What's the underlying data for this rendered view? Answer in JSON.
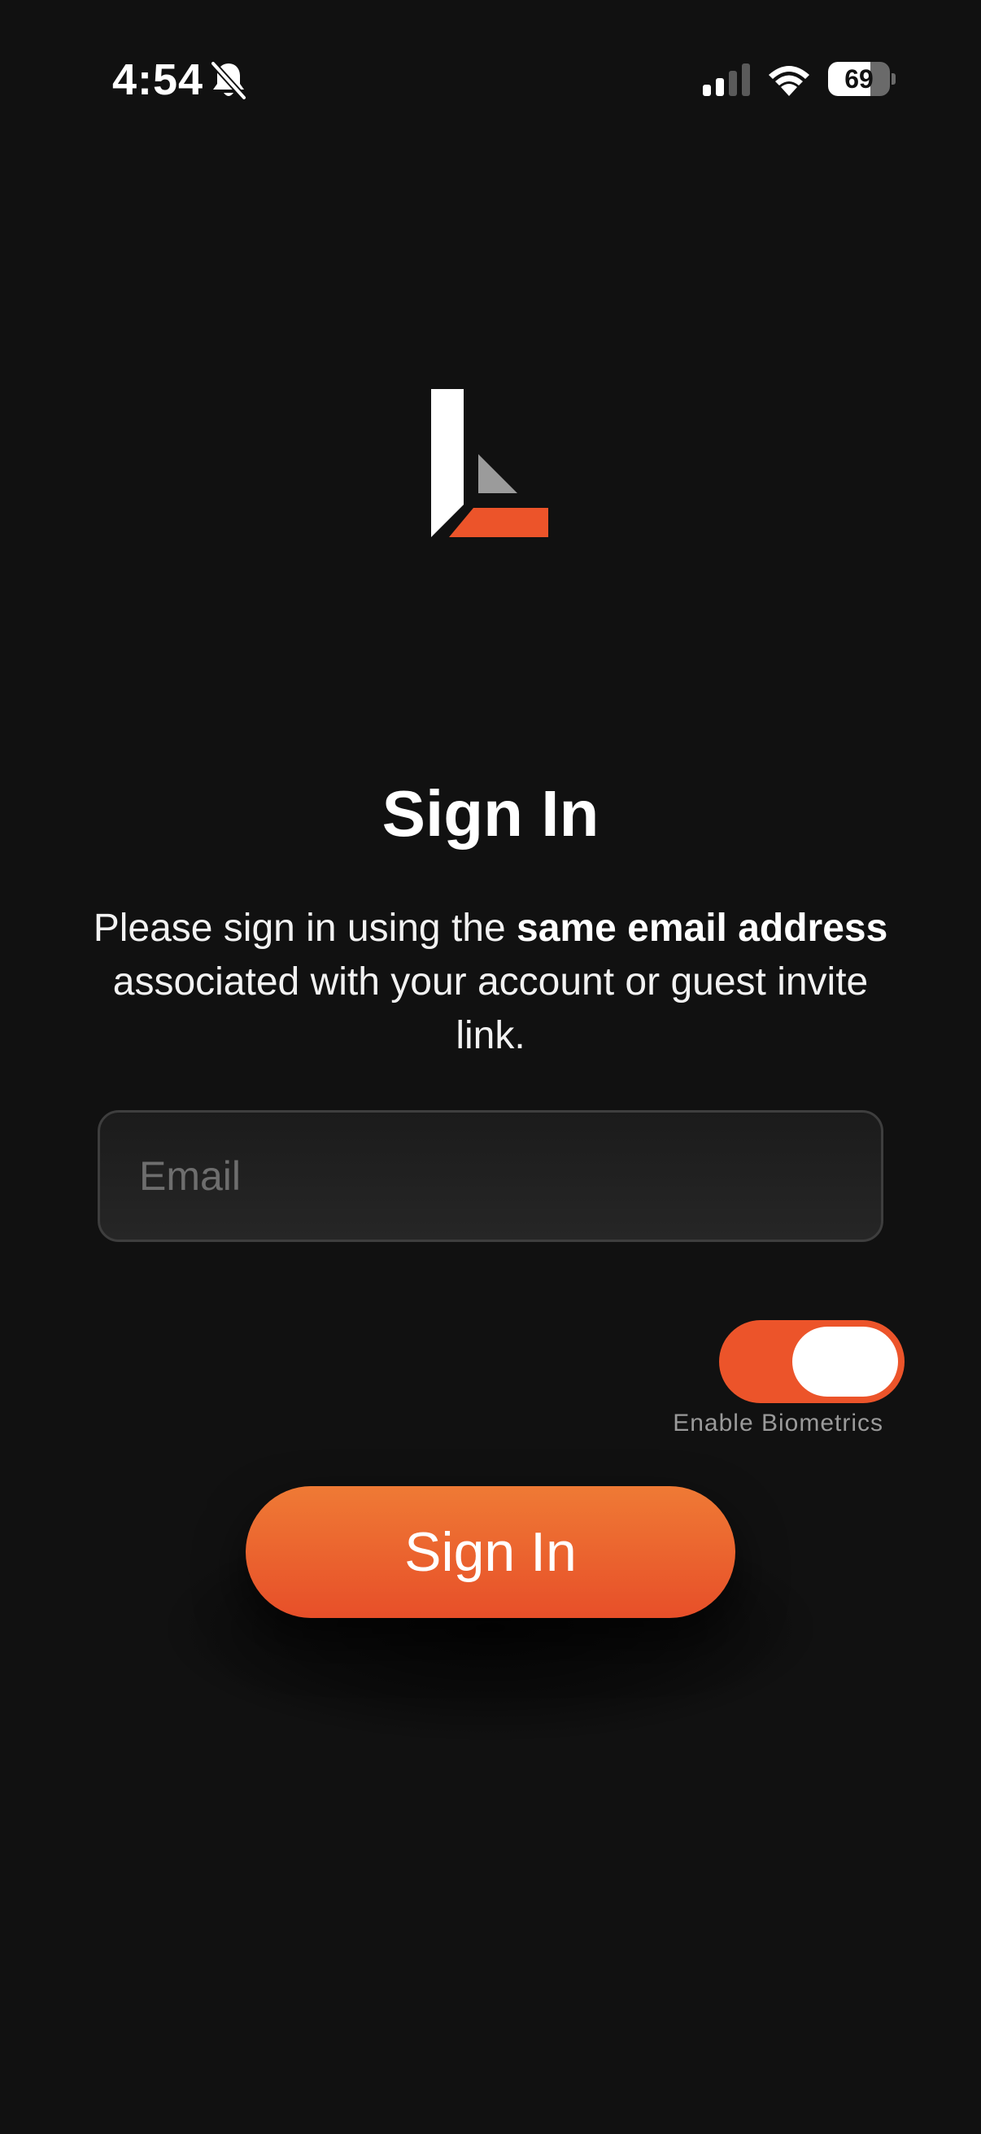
{
  "status_bar": {
    "time": "4:54",
    "battery_level": "69",
    "battery_fraction": 0.69,
    "icons": [
      "bell-slash-icon",
      "signal-icon",
      "wifi-icon",
      "battery-icon"
    ]
  },
  "brand": {
    "logo_icon": "l-logo-icon",
    "accent_color": "#EC542A",
    "logo_grey": "#9B9B9B",
    "logo_white": "#FFFFFF"
  },
  "sign_in": {
    "title": "Sign In",
    "description_part1": "Please sign in using the ",
    "description_bold": "same email address",
    "description_part2": " associated with your account or guest invite link.",
    "email_placeholder": "Email",
    "email_value": "",
    "biometrics_label": "Enable Biometrics",
    "biometrics_enabled": true,
    "button_label": "Sign In"
  },
  "colors": {
    "background": "#111111",
    "button_top": "#EF7A35",
    "button_bottom": "#E74F29",
    "field_border": "#3E3E3E",
    "muted_text": "#9A9A9A"
  }
}
